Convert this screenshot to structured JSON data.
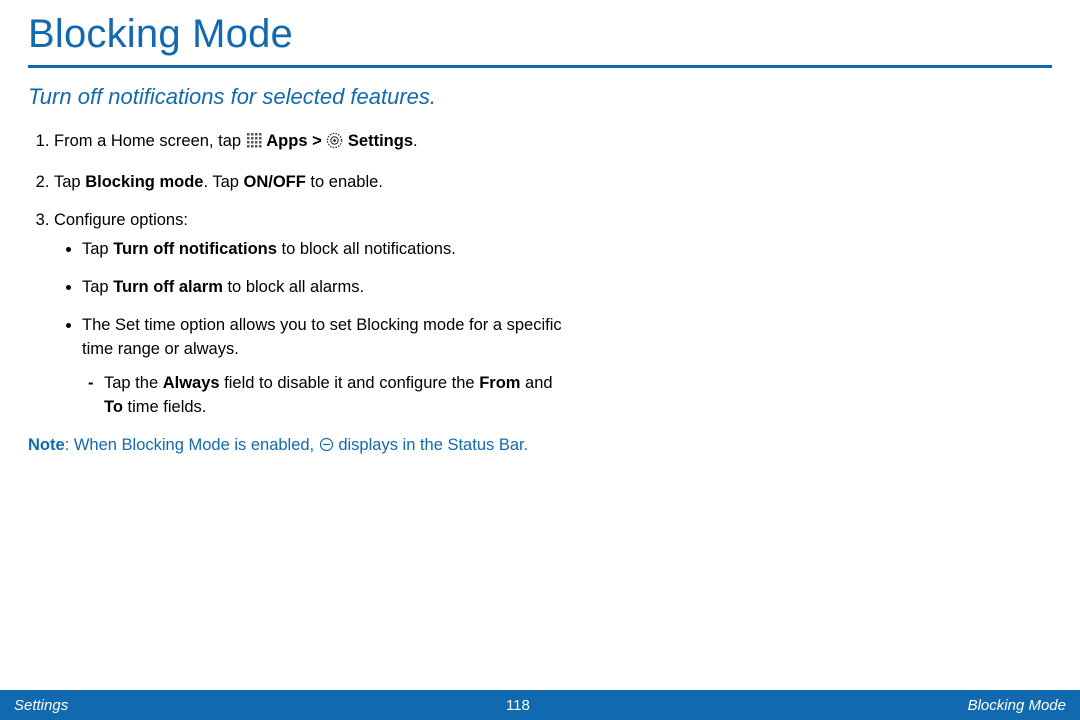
{
  "title": "Blocking Mode",
  "intro": "Turn off notifications for selected features.",
  "steps": {
    "s1": {
      "t1": "From a Home screen, tap ",
      "apps": "Apps",
      "gt": " > ",
      "settings": "Settings",
      "dot": "."
    },
    "s2": {
      "t1": "Tap ",
      "bm": "Blocking mode",
      "t2": ". Tap ",
      "onoff": "ON/OFF",
      "t3": " to enable."
    },
    "s3": {
      "t1": "Configure options:",
      "b1": {
        "a": "Tap ",
        "b": "Turn off notifications",
        "c": " to block all notifications."
      },
      "b2": {
        "a": "Tap ",
        "b": "Turn off alarm",
        "c": " to block all alarms."
      },
      "b3": {
        "a": "The Set time option allows you to set Blocking mode for a specific time range or always."
      },
      "d1": {
        "a": "Tap the ",
        "b": "Always",
        "c": " field to disable it and configure the ",
        "d": "From",
        "e": " and ",
        "f": "To",
        "g": " time fields."
      }
    }
  },
  "note": {
    "label": "Note",
    "t1": ": When Blocking Mode is enabled, ",
    "t2": " displays in the Status Bar."
  },
  "footer": {
    "left": "Settings",
    "center": "118",
    "right": "Blocking Mode"
  }
}
